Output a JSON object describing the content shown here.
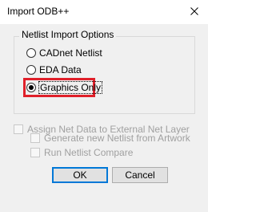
{
  "window": {
    "title": "Import ODB++",
    "close_icon": "close-icon"
  },
  "netlist_group": {
    "legend": "Netlist Import Options",
    "options": [
      {
        "label": "CADnet Netlist",
        "selected": false
      },
      {
        "label": "EDA Data",
        "selected": false
      },
      {
        "label": "Graphics Only",
        "selected": true
      }
    ]
  },
  "checkboxes": {
    "assign_net": {
      "label": "Assign Net Data to External Net Layer",
      "checked": false,
      "enabled": false
    },
    "generate_netlist": {
      "label": "Generate new Netlist from Artwork",
      "checked": false,
      "enabled": false
    },
    "run_compare": {
      "label": "Run Netlist Compare",
      "checked": false,
      "enabled": false
    }
  },
  "buttons": {
    "ok_label": "OK",
    "cancel_label": "Cancel"
  },
  "colors": {
    "highlight": "#e0202a",
    "default_button_border": "#0078d7",
    "disabled_text": "#a0a0a0"
  }
}
